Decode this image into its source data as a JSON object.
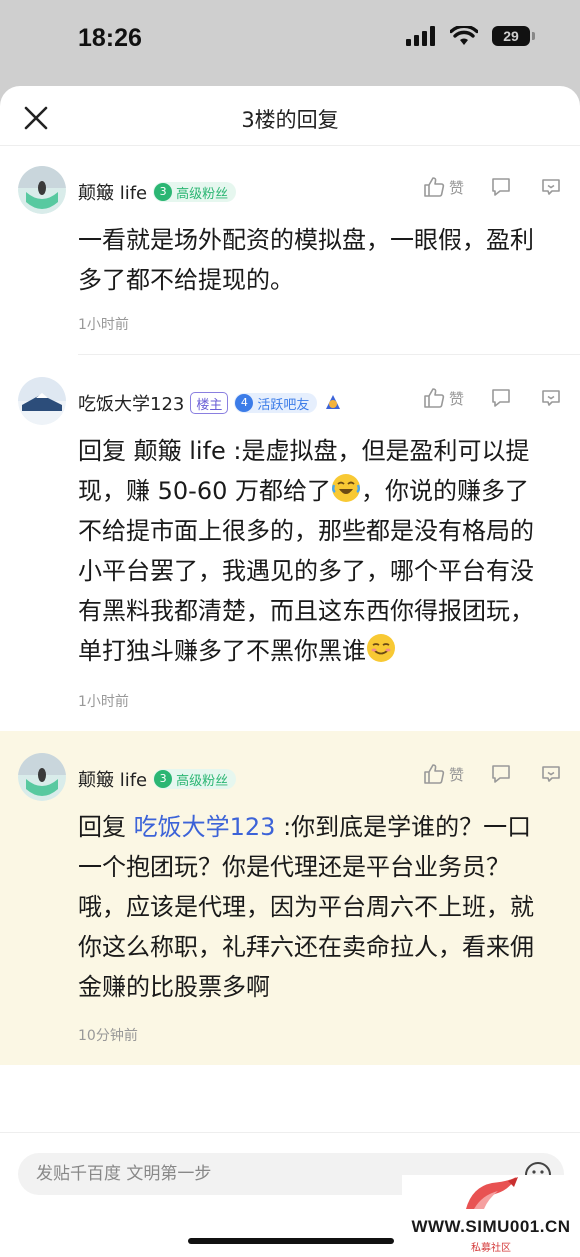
{
  "status_bar": {
    "time": "18:26",
    "battery": "29"
  },
  "sheet": {
    "title": "3楼的回复"
  },
  "comments": [
    {
      "author": "颠簸 life",
      "fan_level": "3",
      "fan_badge": "高级粉丝",
      "like_label": "赞",
      "content": "一看就是场外配资的模拟盘，一眼假，盈利多了都不给提现的。",
      "time": "1小时前"
    },
    {
      "author": "吃饭大学123",
      "owner_badge": "楼主",
      "active_level": "4",
      "active_badge": "活跃吧友",
      "like_label": "赞",
      "reply_prefix": "回复 颠簸 life :",
      "content_part1": "是虚拟盘，但是盈利可以提现，赚 50-60 万都给了",
      "content_part2": "，你说的赚多了不给提市面上很多的，那些都是没有格局的小平台罢了，我遇见的多了，哪个平台有没有黑料我都清楚，而且这东西你得报团玩，单打独斗赚多了不黑你黑谁",
      "time": "1小时前"
    },
    {
      "author": "颠簸 life",
      "fan_level": "3",
      "fan_badge": "高级粉丝",
      "like_label": "赞",
      "reply_word": "回复 ",
      "reply_mention": "吃饭大学123",
      "content": " :你到底是学谁的？一口一个抱团玩？你是代理还是平台业务员？哦，应该是代理，因为平台周六不上班，就你这么称职，礼拜六还在卖命拉人，看来佣金赚的比股票多啊",
      "time": "10分钟前"
    }
  ],
  "input": {
    "placeholder": "发贴千百度 文明第一步"
  },
  "watermark": {
    "text": "WWW.SIMU001.CN",
    "sub": "私募社区"
  }
}
